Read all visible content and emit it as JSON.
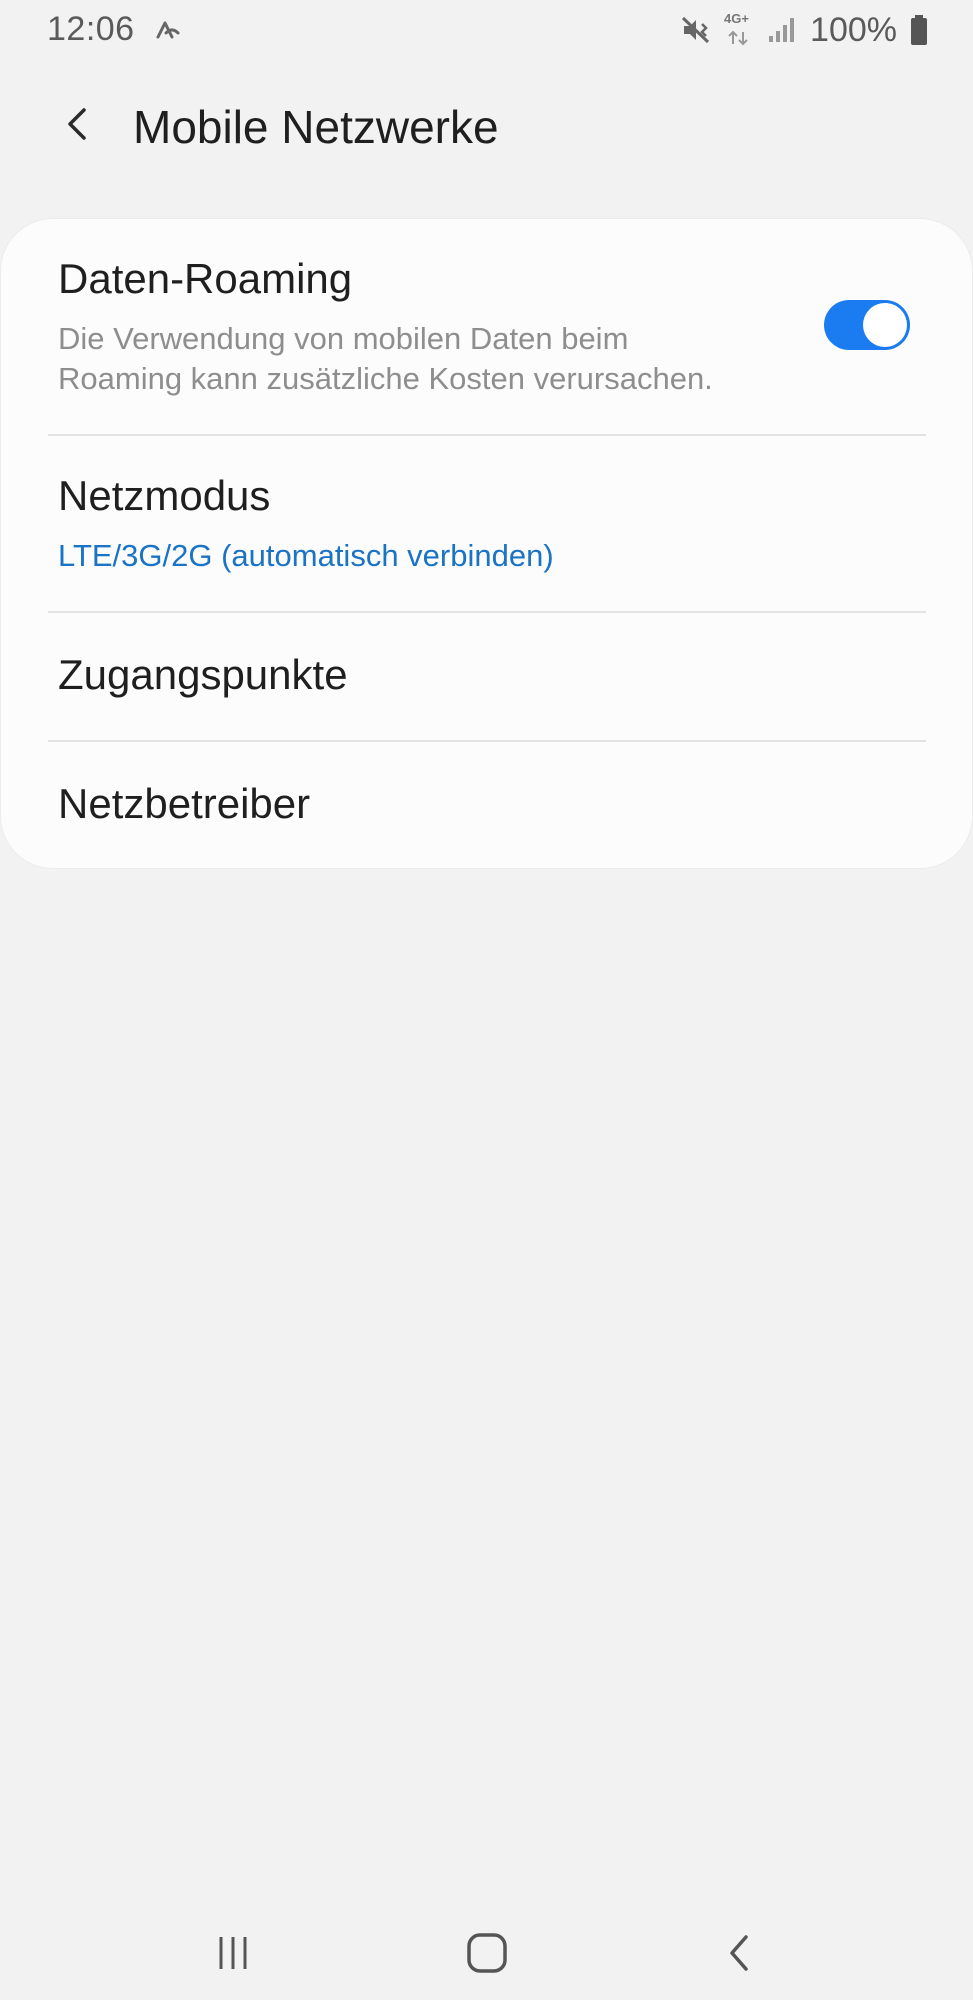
{
  "status_bar": {
    "time": "12:06",
    "network_type": "4G+",
    "battery": "100%",
    "icons": [
      "signal-nfc-icon",
      "mute-vibrate-icon",
      "network-4g-icon",
      "signal-strength-icon",
      "battery-icon"
    ]
  },
  "header": {
    "title": "Mobile Netzwerke",
    "back_icon": "chevron-left-icon"
  },
  "settings": {
    "items": [
      {
        "title": "Daten-Roaming",
        "subtitle_line1": "Die Verwendung von mobilen Daten beim",
        "subtitle_line2": "Roaming kann zusätzliche Kosten verursachen.",
        "toggle_on": true
      },
      {
        "title": "Netzmodus",
        "subtitle": "LTE/3G/2G (automatisch verbinden)"
      },
      {
        "title": "Zugangspunkte"
      },
      {
        "title": "Netzbetreiber"
      }
    ]
  },
  "nav_bar": {
    "icons": [
      "recent-apps-icon",
      "home-icon",
      "back-icon"
    ]
  },
  "colors": {
    "background": "#f2f2f2",
    "card": "#fcfcfc",
    "accent": "#1a7cf0",
    "subtitle_blue": "#1a73c4",
    "subtitle_gray": "#8e8e8e"
  }
}
